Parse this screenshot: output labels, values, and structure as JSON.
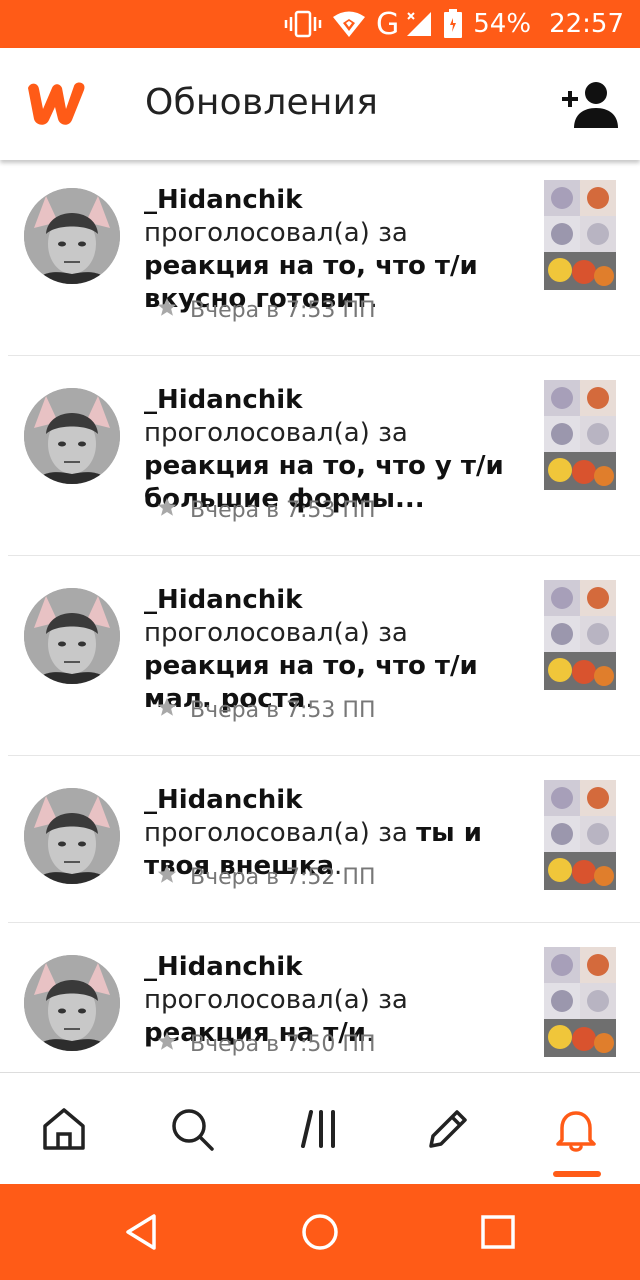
{
  "status_bar": {
    "battery": "54%",
    "time": "22:57",
    "network": "G",
    "icons": [
      "vibrate-icon",
      "wifi-icon",
      "signal-icon",
      "battery-icon"
    ]
  },
  "app_bar": {
    "title": "Обновления",
    "logo": "wattpad-logo",
    "action_icon": "add-person-icon"
  },
  "feed": [
    {
      "user": "_Hidanchik",
      "action": "проголосовал(а)",
      "prep": "за",
      "story": "реакция на то, что т/и вкусно готовит",
      "suffix": ".",
      "time": "Вчера в 7:53 ПП"
    },
    {
      "user": "_Hidanchik",
      "action": "проголосовал(а)",
      "prep": "за",
      "story": "реакция на то, что у т/и большие формы...",
      "suffix": "",
      "time": "Вчера в 7:53 ПП"
    },
    {
      "user": "_Hidanchik",
      "action": "проголосовал(а)",
      "prep": "за",
      "story": "реакция на то, что т/и мал. роста",
      "suffix": ".",
      "time": "Вчера в 7:53 ПП"
    },
    {
      "user": "_Hidanchik",
      "action": "проголосовал(а)",
      "prep": "за",
      "story": "ты и твоя внешка",
      "suffix": ".",
      "time": "Вчера в 7:52 ПП"
    },
    {
      "user": "_Hidanchik",
      "action": "проголосовал(а)",
      "prep": "за",
      "story": "реакция на т/и",
      "suffix": ".",
      "time": "Вчера в 7:50 ПП"
    }
  ],
  "bottom_nav": {
    "items": [
      "home-icon",
      "search-icon",
      "library-icon",
      "write-icon",
      "notifications-icon"
    ],
    "active": "notifications-icon",
    "accent": "#ff5b17"
  },
  "system_nav": {
    "items": [
      "back-icon",
      "home-circle-icon",
      "recents-icon"
    ]
  },
  "colors": {
    "brand": "#ff5b17",
    "text": "#222222",
    "muted": "#777777"
  }
}
